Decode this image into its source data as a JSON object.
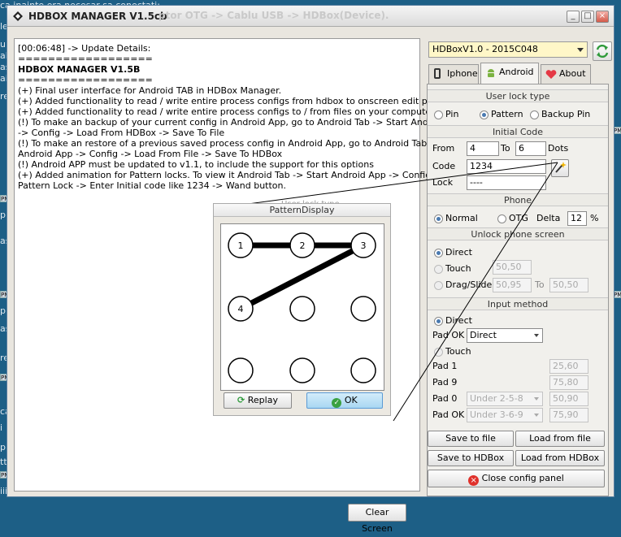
{
  "background": {
    "lines": [
      "ca inainte era necesar sa conectati:",
      "le",
      "tt",
      "ur",
      "al",
      "as",
      "ai",
      "re",
      "pl",
      "as",
      "pl",
      "as",
      "re",
      "ea",
      "ca",
      "re",
      "i",
      "a",
      "pr",
      "tt",
      "iii"
    ],
    "pm_tabs": [
      "PM",
      "PM",
      "PM",
      "PM",
      "PM",
      "PM"
    ]
  },
  "window": {
    "title": "HDBOX MANAGER V1.5cb",
    "behind_title": "ptor OTG -> Cablu USB -> HDBox(Device).",
    "minimize": "_",
    "maximize": "□",
    "close": "×"
  },
  "log": {
    "lines": [
      "[00:06:48] -> Update Details:",
      "==================",
      "HDBOX MANAGER V1.5B",
      "==================",
      "(+) Final user interface for Android TAB in HDBox Manager.",
      "(+) Added functionality to read / write entire process configs from hdbox to onscreen edit page,",
      "(+) Added functionality to read / write entire process configs to / from files on your computer",
      "(!) To make an backup of your current config in Android App, go to Android Tab -> Start Android App",
      "-> Config -> Load From HDBox -> Save To File",
      "(!) To make an restore of a previous saved process config in Android App, go to Android Tab -> Start",
      "Android App -> Config -> Load From File -> Save To HDBox",
      "(!) Android APP must be updated to v1.1, to include the support for this options",
      "(+) Added animation for Pattern locks. To view it Android Tab -> Start Android App -> Config ->",
      "Pattern Lock -> Enter Initial code like 1234 ->  Wand button."
    ],
    "clear_button": "Clear Screen"
  },
  "pattern_display": {
    "under_label": "User lock type",
    "title": "PatternDisplay",
    "dots": [
      "1",
      "2",
      "3",
      "4",
      "",
      "",
      "",
      "",
      ""
    ],
    "path": [
      1,
      2,
      3,
      4
    ],
    "replay_button": "Replay",
    "ok_button": "OK"
  },
  "panel": {
    "device": "HDBoxV1.0 - 2015C048",
    "tabs": [
      "Iphone",
      "Android",
      "About"
    ],
    "active_tab": "Android",
    "user_lock": {
      "header": "User lock type",
      "options": [
        "Pin",
        "Pattern",
        "Backup Pin"
      ],
      "selected": "Pattern"
    },
    "initial_code": {
      "header": "Initial Code",
      "from_label": "From",
      "from_value": "4",
      "to_label": "To",
      "to_value": "6",
      "dots_label": "Dots",
      "code_label": "Code",
      "code_value": "1234",
      "lock_label": "Lock",
      "lock_value": "----"
    },
    "phone": {
      "header": "Phone",
      "options": [
        "Normal",
        "OTG"
      ],
      "selected": "Normal",
      "delta_label": "Delta",
      "delta_value": "12",
      "delta_unit": "%"
    },
    "unlock_screen": {
      "header": "Unlock phone screen",
      "options": [
        "Direct",
        "Touch",
        "Drag/Slide"
      ],
      "selected": "Direct",
      "touch_value": "50,50",
      "drag_from": "50,95",
      "to_label": "To",
      "drag_to": "50,50"
    },
    "input_method": {
      "header": "Input method",
      "direct_label": "Direct",
      "pad_ok_label": "Pad OK",
      "pad_ok_value": "Direct",
      "touch_label": "Touch",
      "rows": [
        {
          "label": "Pad 1",
          "select": "",
          "value": "25,60"
        },
        {
          "label": "Pad 9",
          "select": "",
          "value": "75,80"
        },
        {
          "label": "Pad 0",
          "select": "Under 2-5-8",
          "value": "50,90"
        },
        {
          "label": "Pad OK",
          "select": "Under 3-6-9",
          "value": "75,90"
        }
      ]
    },
    "buttons": {
      "save_file": "Save to file",
      "load_file": "Load from file",
      "save_hdbox": "Save to HDBox",
      "load_hdbox": "Load from HDBox",
      "close_panel": "Close config panel"
    }
  }
}
